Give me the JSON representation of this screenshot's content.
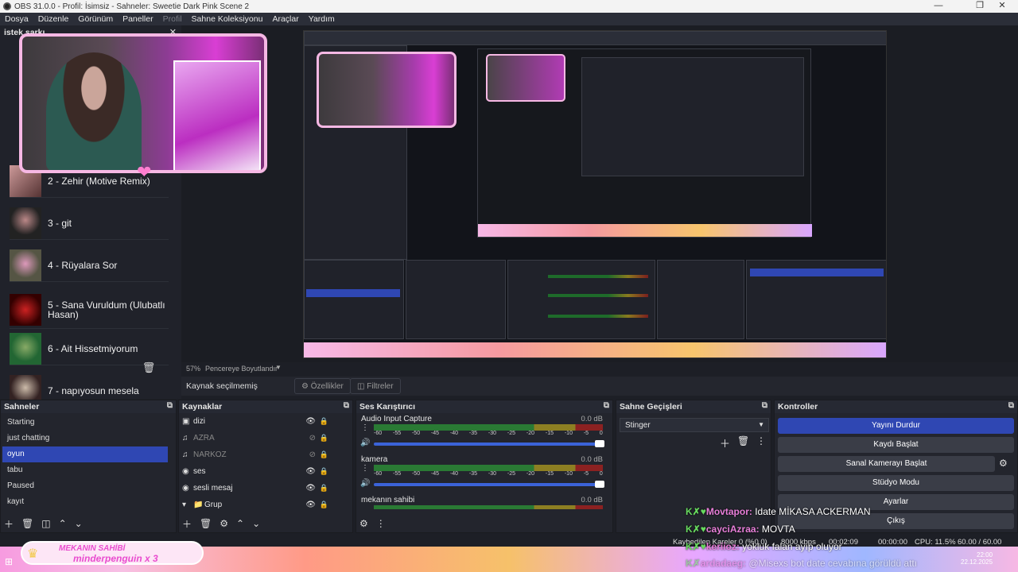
{
  "window": {
    "title": "OBS 31.0.0 - Profil: İsimsiz - Sahneler: Sweetie Dark Pink Scene 2"
  },
  "menu": [
    "Dosya",
    "Düzenle",
    "Görünüm",
    "Paneller",
    "Profil",
    "Sahne Koleksiyonu",
    "Araçlar",
    "Yardım"
  ],
  "left_dock": {
    "title": "istek şarkı",
    "songs": [
      "2 - Zehir (Motive Remix)",
      "3 - git",
      "4 - Rüyalara Sor",
      "5 - Sana Vuruldum (Ulubatlı Hasan)",
      "6 - Ait Hissetmiyorum",
      "7 - napıyosun mesela"
    ]
  },
  "preview": {
    "zoom": "57%",
    "fit_label": "Pencereye Boyutlandır"
  },
  "selection": {
    "label": "Kaynak seçilmemiş",
    "properties": "Özellikler",
    "filters": "Filtreler"
  },
  "scenes": {
    "title": "Sahneler",
    "items": [
      "Starting",
      "just chatting",
      "oyun",
      "tabu",
      "Paused",
      "kayıt"
    ],
    "selected": "oyun"
  },
  "sources": {
    "title": "Kaynaklar",
    "items": [
      {
        "name": "dizi",
        "icon": "monitor-icon",
        "visible": true
      },
      {
        "name": "AZRA",
        "icon": "audio-icon",
        "visible": false
      },
      {
        "name": "NARKOZ",
        "icon": "audio-icon",
        "visible": false
      },
      {
        "name": "ses",
        "icon": "globe-icon",
        "visible": true
      },
      {
        "name": "sesli mesaj",
        "icon": "globe-icon",
        "visible": true
      },
      {
        "name": "Grup",
        "icon": "folder-icon",
        "visible": true
      }
    ]
  },
  "mixer": {
    "title": "Ses Karıştırıcı",
    "channels": [
      {
        "name": "Audio Input Capture",
        "db": "0.0 dB"
      },
      {
        "name": "kamera",
        "db": "0.0 dB"
      },
      {
        "name": "mekanın sahibi",
        "db": "0.0 dB"
      }
    ],
    "scale": [
      "-60",
      "-55",
      "-50",
      "-45",
      "-40",
      "-35",
      "-30",
      "-25",
      "-20",
      "-15",
      "-10",
      "-5",
      "0"
    ]
  },
  "transitions": {
    "title": "Sahne Geçişleri",
    "selected": "Stinger"
  },
  "controls": {
    "title": "Kontroller",
    "buttons": [
      "Yayını Durdur",
      "Kaydı Başlat",
      "Sanal Kamerayı Başlat",
      "Stüdyo Modu",
      "Ayarlar",
      "Çıkış"
    ]
  },
  "chat": [
    {
      "user": "Movtapor:",
      "message": "Idate MİKASA ACKERMAN"
    },
    {
      "user": "cayciAzraa:",
      "message": "MOVTA"
    },
    {
      "user": "keriioz:",
      "message": "yokluk falan ayıp oluyor"
    },
    {
      "user": "ardadaeg:",
      "message": "@Misexs bot date cevabına görüldü attı"
    }
  ],
  "banner": {
    "line1": "MEKANIN SAHİBİ",
    "line2": "minderpenguin x 3"
  },
  "status": {
    "dropped": "Kaybedilen Kareler 0 (%0.0)",
    "bitrate": "8000 kbps",
    "live": "00:02:09",
    "rec": "00:00:00",
    "cpu": "CPU: 11.5%",
    "fps": "60.00 / 60.00 FPS"
  },
  "clock": {
    "time": "22:00",
    "date": "22.12.2025"
  },
  "colors": {
    "accent": "#2f47b3",
    "pink": "#f6b8e4"
  }
}
